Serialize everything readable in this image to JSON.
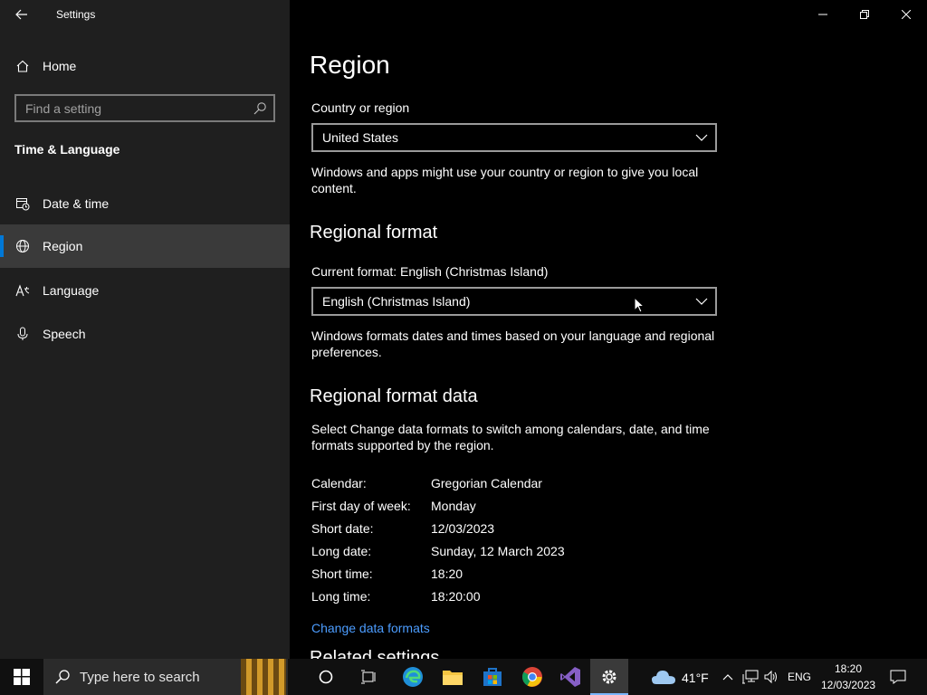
{
  "window": {
    "title": "Settings"
  },
  "sidebar": {
    "home_label": "Home",
    "search_placeholder": "Find a setting",
    "section_heading": "Time & Language",
    "items": [
      {
        "label": "Date & time",
        "icon": "calendar-clock-icon",
        "active": false
      },
      {
        "label": "Region",
        "icon": "globe-icon",
        "active": true
      },
      {
        "label": "Language",
        "icon": "language-icon",
        "active": false
      },
      {
        "label": "Speech",
        "icon": "microphone-icon",
        "active": false
      }
    ]
  },
  "main": {
    "page_title": "Region",
    "country": {
      "label": "Country or region",
      "value": "United States",
      "description": "Windows and apps might use your country or region to give you local content."
    },
    "regional_format": {
      "heading": "Regional format",
      "label": "Current format: English (Christmas Island)",
      "value": "English (Christmas Island)",
      "description": "Windows formats dates and times based on your language and regional preferences."
    },
    "format_data": {
      "heading": "Regional format data",
      "description": "Select Change data formats to switch among calendars, date, and time formats supported by the region.",
      "rows": [
        {
          "key": "Calendar:",
          "value": "Gregorian Calendar"
        },
        {
          "key": "First day of week:",
          "value": "Monday"
        },
        {
          "key": "Short date:",
          "value": "12/03/2023"
        },
        {
          "key": "Long date:",
          "value": "Sunday, 12 March 2023"
        },
        {
          "key": "Short time:",
          "value": "18:20"
        },
        {
          "key": "Long time:",
          "value": "18:20:00"
        }
      ],
      "link": "Change data formats"
    },
    "cut_heading": "Related settings"
  },
  "taskbar": {
    "search_placeholder": "Type here to search",
    "weather_temp": "41°F",
    "language": "ENG",
    "time": "18:20",
    "date": "12/03/2023"
  },
  "colors": {
    "accent": "#0078d7",
    "link": "#4c9dff",
    "sidebar_bg": "#1f1f1f",
    "active_bg": "#3a3a3a"
  }
}
